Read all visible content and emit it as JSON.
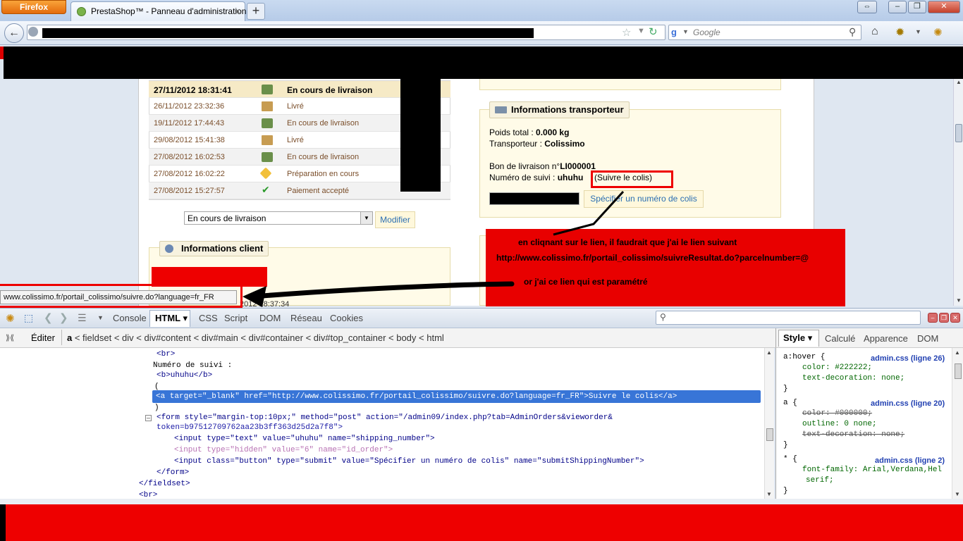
{
  "browser": {
    "menu_button": "Firefox",
    "tab_title": "PrestaShop™ - Panneau d'administration",
    "tab_close": "×",
    "new_tab": "+",
    "search_placeholder": "Google",
    "win_restore": "⇔",
    "win_min": "–",
    "win_max": "❐",
    "win_close": "✕"
  },
  "history": {
    "rows": [
      {
        "date": "27/11/2012 18:31:41",
        "status": "En cours de livraison",
        "icon": "truck-icon"
      },
      {
        "date": "26/11/2012 23:32:36",
        "status": "Livré",
        "icon": "box-icon"
      },
      {
        "date": "19/11/2012 17:44:43",
        "status": "En cours de livraison",
        "icon": "truck-icon"
      },
      {
        "date": "29/08/2012 15:41:38",
        "status": "Livré",
        "icon": "box-icon"
      },
      {
        "date": "27/08/2012 16:02:53",
        "status": "En cours de livraison",
        "icon": "truck-icon"
      },
      {
        "date": "27/08/2012 16:02:22",
        "status": "Préparation en cours",
        "icon": "parcel-icon"
      },
      {
        "date": "27/08/2012 15:27:57",
        "status": "Paiement accepté",
        "icon": "check-icon"
      }
    ]
  },
  "status_form": {
    "selected": "En cours de livraison",
    "button": "Modifier"
  },
  "client": {
    "legend": "Informations client",
    "partial_date": "2012 18:37:34"
  },
  "carrier": {
    "legend": "Informations transporteur",
    "weight_label": "Poids total : ",
    "weight_value": "0.000 kg",
    "carrier_label": "Transporteur : ",
    "carrier_value": "Colissimo",
    "delivery_label": "Bon de livraison n°",
    "delivery_value": "LI000001",
    "tracking_label": "Numéro de suivi : ",
    "tracking_value": "uhuhu",
    "follow_link": "(Suivre le colis)",
    "spec_button": "Spécifier un numéro de colis"
  },
  "annotation": {
    "line1": "en cliqnant sur le lien, il faudrait que j'ai le lien suivant",
    "line2": "http://www.colissimo.fr/portail_colissimo/suivreResultat.do?parcelnumber=@",
    "line3": "or j'ai ce lien qui est paramétré"
  },
  "statusbar": {
    "url": "www.colissimo.fr/portail_colissimo/suivre.do?language=fr_FR"
  },
  "firebug": {
    "tabs": [
      "Console",
      "HTML",
      "CSS",
      "Script",
      "DOM",
      "Réseau",
      "Cookies"
    ],
    "edit": "Éditer",
    "breadcrumb_first": "a",
    "breadcrumb_rest": " < fieldset < div < div#content < div#main < div#container < div#top_container < body < html",
    "side_tabs": [
      "Style",
      "Calculé",
      "Apparence",
      "DOM"
    ],
    "html_lines": {
      "br1": "<br>",
      "num": "Numéro de suivi :",
      "b": "<b>uhuhu</b>",
      "paren_open": "(",
      "selected": "<a target=\"_blank\" href=\"http://www.colissimo.fr/portail_colissimo/suivre.do?language=fr_FR\">Suivre le colis</a>",
      "paren_close": ")",
      "form1": "<form style=\"margin-top:10px;\" method=\"post\" action=\"/admin09/index.php?tab=AdminOrders&vieworder&",
      "form2": "token=b97512709762aa23b3ff363d25d2a7f8\">",
      "input1": "<input type=\"text\" value=\"uhuhu\" name=\"shipping_number\">",
      "input2": "<input type=\"hidden\" value=\"6\" name=\"id_order\">",
      "input3": "<input class=\"button\" type=\"submit\" value=\"Spécifier un numéro de colis\" name=\"submitShippingNumber\">",
      "form_close": "</form>",
      "fieldset_close": "</fieldset>",
      "br2": "<br>"
    },
    "css_rules": {
      "r1_sel": "a:hover {",
      "r1_src": "admin.css (ligne 26)",
      "r1_p1": "color: #222222;",
      "r1_p2": "text-decoration: none;",
      "r2_sel": "a {",
      "r2_src": "admin.css (ligne 20)",
      "r2_p1": "color: #000000;",
      "r2_p2": "outline: 0 none;",
      "r2_p3": "text-decoration: none;",
      "r3_sel": "* {",
      "r3_src": "admin.css (ligne 2)",
      "r3_p1": "font-family: Arial,Verdana,Hel",
      "r3_p2": "serif;",
      "close": "}"
    }
  },
  "colors": {
    "annotation_red": "#e80000",
    "selection_blue": "#3875d7",
    "link_blue": "#2b6fb2"
  }
}
